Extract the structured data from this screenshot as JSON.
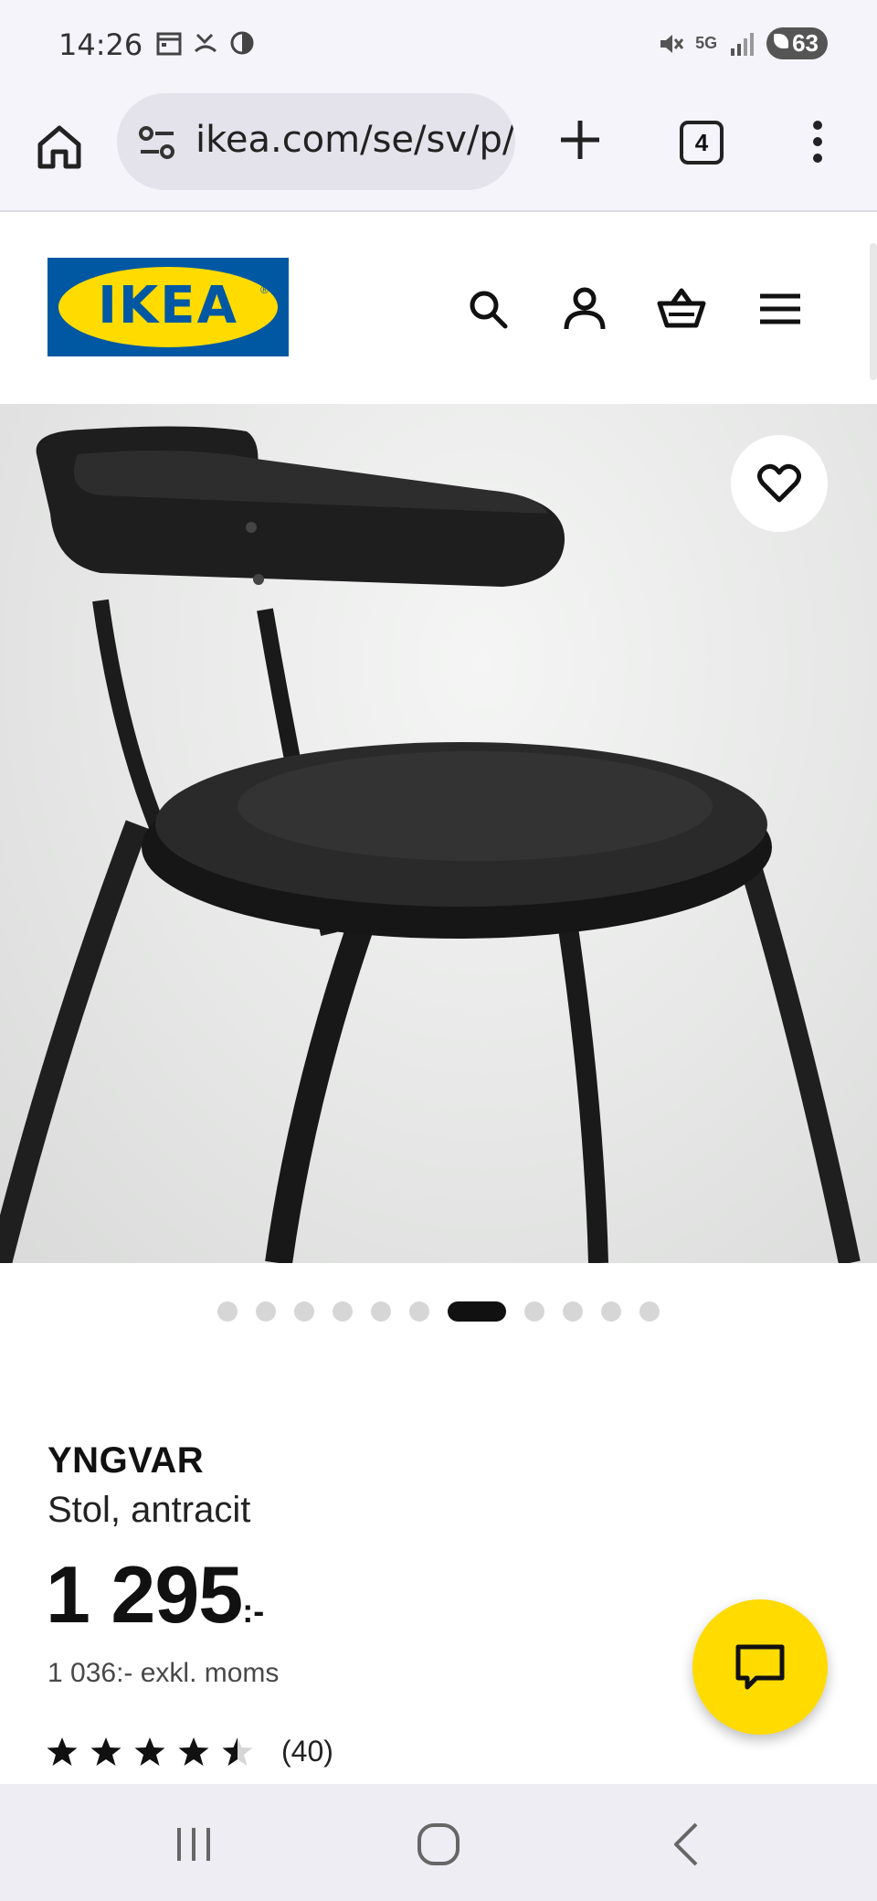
{
  "status_bar": {
    "time": "14:26",
    "network": "5G",
    "battery": "63",
    "icons": [
      "calendar-icon",
      "missed-call-icon",
      "data-saver-icon",
      "mute-icon",
      "signal-icon",
      "battery-icon"
    ]
  },
  "browser": {
    "url": "ikea.com/se/sv/p/yngvar-stol-antracit",
    "tab_count": "4"
  },
  "site": {
    "logo_text": "IKEA",
    "logo_colors": {
      "blue": "#0058a3",
      "yellow": "#ffdb00"
    },
    "header_icons": [
      "search-icon",
      "account-icon",
      "cart-icon",
      "menu-icon"
    ]
  },
  "gallery": {
    "image_count": 11,
    "active_index": 6
  },
  "product": {
    "name": "YNGVAR",
    "description": "Stol, antracit",
    "price_main": "1 295",
    "price_suffix": ":-",
    "price_ex_vat": "1 036:- exkl. moms",
    "rating": 4.5,
    "rating_max": 5,
    "review_count": "(40)"
  },
  "colors": {
    "chat_button": "#ffdb00",
    "active_dot": "#111111"
  }
}
